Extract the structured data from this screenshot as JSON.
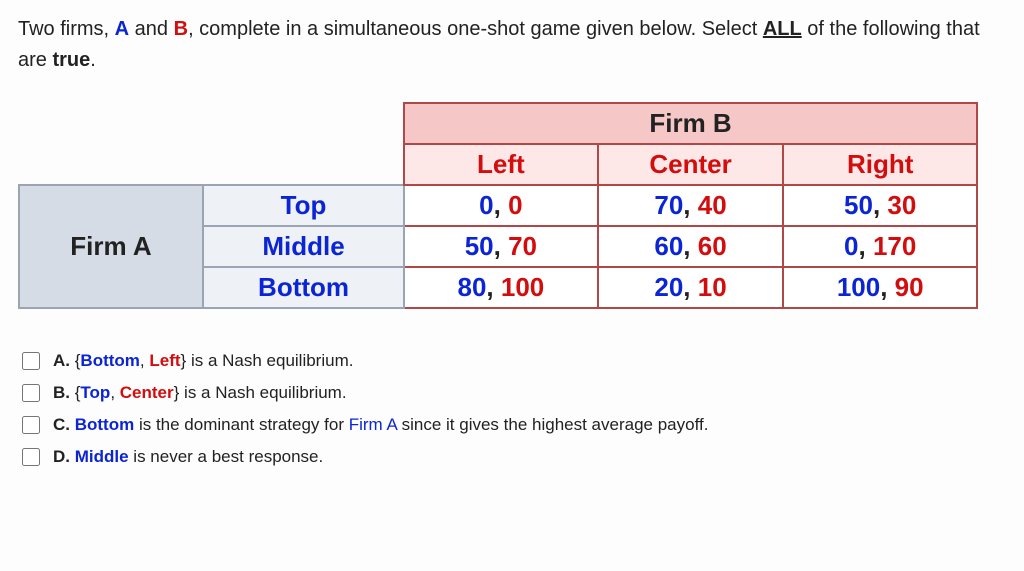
{
  "question": {
    "p1": "Two firms, ",
    "firmA": "A",
    "mid1": " and ",
    "firmB": "B",
    "p2": ", complete in a simultaneous one-shot game given below. Select ",
    "all": "ALL",
    "p3": " of the following that are ",
    "true": "true",
    "p4": "."
  },
  "table": {
    "firmB_label": "Firm B",
    "firmA_label": "Firm A",
    "b_strategies": [
      "Left",
      "Center",
      "Right"
    ],
    "a_strategies": [
      "Top",
      "Middle",
      "Bottom"
    ],
    "payoffs": [
      [
        [
          0,
          0
        ],
        [
          70,
          40
        ],
        [
          50,
          30
        ]
      ],
      [
        [
          50,
          70
        ],
        [
          60,
          60
        ],
        [
          0,
          170
        ]
      ],
      [
        [
          80,
          100
        ],
        [
          20,
          10
        ],
        [
          100,
          90
        ]
      ]
    ]
  },
  "answers": {
    "A": {
      "letter": "A. ",
      "open": "{",
      "s1": "Bottom",
      "sep": ", ",
      "s2": "Left",
      "close": "}",
      "tail": " is a Nash equilibrium."
    },
    "B": {
      "letter": "B. ",
      "open": "{",
      "s1": "Top",
      "sep": ", ",
      "s2": "Center",
      "close": "}",
      "tail": " is a Nash equilibrium."
    },
    "C": {
      "letter": "C. ",
      "s1": "Bottom",
      "mid1": " is the dominant strategy for ",
      "firmA": "Firm A",
      "tail": " since it gives the highest average payoff."
    },
    "D": {
      "letter": "D. ",
      "s1": "Middle",
      "tail": " is never a best response."
    }
  }
}
